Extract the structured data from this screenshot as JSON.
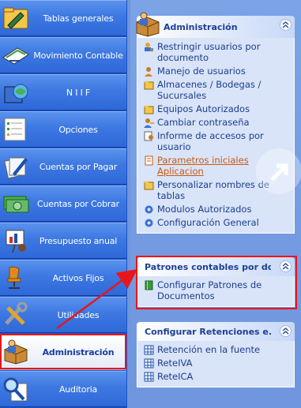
{
  "nav": {
    "items": [
      {
        "label": "Tablas generales",
        "icon": "folder-pencil-icon"
      },
      {
        "label": "Movimiento Contable",
        "icon": "ledger-pen-icon"
      },
      {
        "label": "N I I F",
        "icon": "globe-books-icon"
      },
      {
        "label": "Opciones",
        "icon": "checklist-icon"
      },
      {
        "label": "Cuentas por Pagar",
        "icon": "papers-pen-icon"
      },
      {
        "label": "Cuentas por Cobrar",
        "icon": "money-bills-icon"
      },
      {
        "label": "Presupuesto anual",
        "icon": "presentation-icon"
      },
      {
        "label": "Activos Fijos",
        "icon": "office-chair-icon"
      },
      {
        "label": "Utilidades",
        "icon": "tools-icon"
      },
      {
        "label": "Administración",
        "icon": "admin-box-icon"
      },
      {
        "label": "Auditoria",
        "icon": "magnifier-doc-icon"
      }
    ],
    "active_index": 9
  },
  "panels": {
    "admin": {
      "title": "Administración",
      "links": [
        {
          "label": "Restringir usuarios por documento",
          "icon": "users-lock-icon"
        },
        {
          "label": "Manejo de usuarios",
          "icon": "user-icon"
        },
        {
          "label": "Almacenes / Bodegas / Sucursales",
          "icon": "folder-icon"
        },
        {
          "label": "Equipos Autorizados",
          "icon": "folder-icon"
        },
        {
          "label": "Cambiar contraseña",
          "icon": "user-key-icon"
        },
        {
          "label": "Informe de accesos por usuario",
          "icon": "report-user-icon"
        },
        {
          "label": "Parametros iniciales Aplicacion",
          "icon": "document-icon"
        },
        {
          "label": "Personalizar nombres de tablas",
          "icon": "folder-icon"
        },
        {
          "label": "Modulos Autorizados",
          "icon": "gear-icon"
        },
        {
          "label": "Configuración General",
          "icon": "gear-icon"
        }
      ]
    },
    "patrones": {
      "title": "Patrones contables por do...",
      "links": [
        {
          "label": "Configurar Patrones de Documentos",
          "icon": "green-book-icon"
        }
      ]
    },
    "retenciones": {
      "title": "Configurar Retenciones e...",
      "links": [
        {
          "label": "Retención en la fuente",
          "icon": "grid-doc-icon"
        },
        {
          "label": "ReteIVA",
          "icon": "grid-doc-icon"
        },
        {
          "label": "ReteICA",
          "icon": "grid-doc-icon"
        }
      ]
    }
  },
  "colors": {
    "nav_blue": "#3d78e2",
    "highlight_red": "#e8161b",
    "link_blue": "#1c3d8f",
    "link_orange": "#c85a12"
  }
}
